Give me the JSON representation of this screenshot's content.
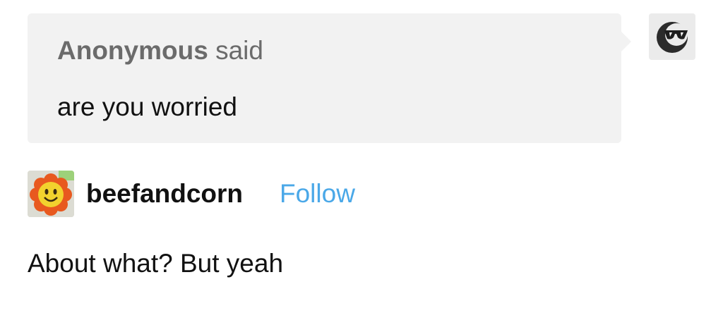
{
  "ask": {
    "asker_name": "Anonymous",
    "said_label": "said",
    "question": "are you worried",
    "bubble_color": "#f2f2f2",
    "asker_avatar_icon": "sunglasses-moon-icon"
  },
  "answer": {
    "blog_name": "beefandcorn",
    "follow_label": "Follow",
    "follow_color": "#4aa8e8",
    "blog_avatar_icon": "smiley-flower-icon",
    "body": "About what? But yeah"
  }
}
